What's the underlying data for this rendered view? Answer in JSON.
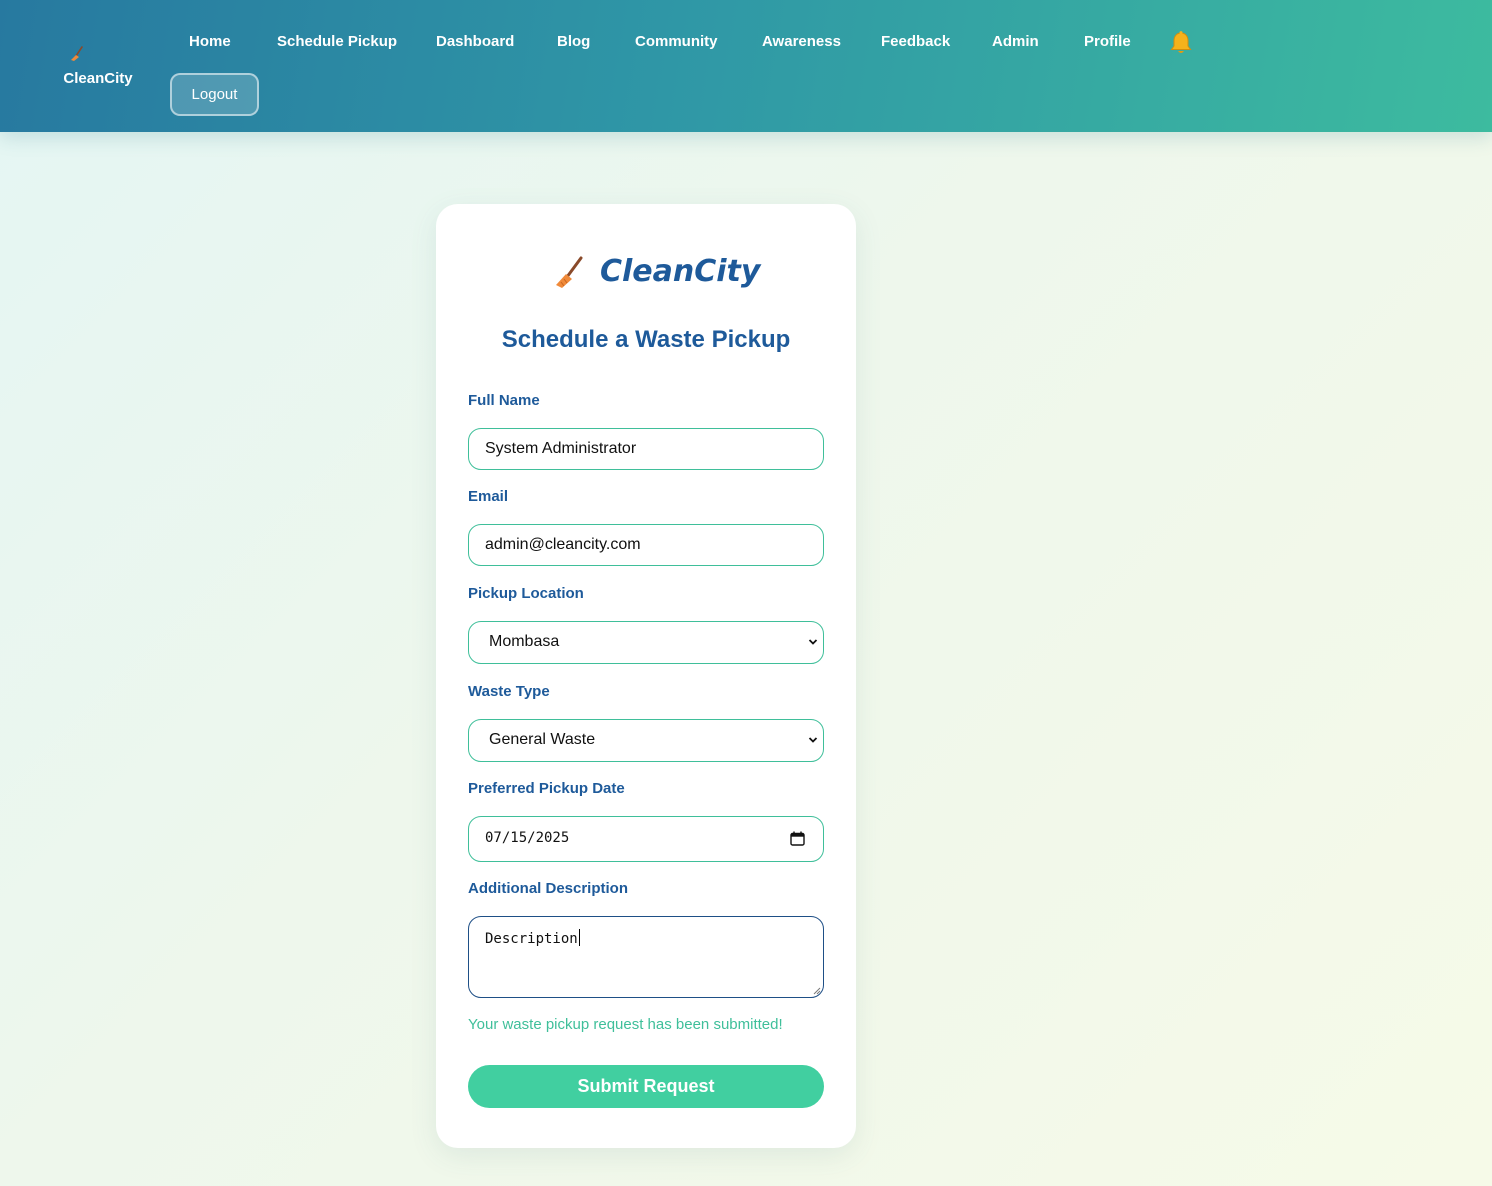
{
  "header": {
    "brand_name": "CleanCity",
    "nav": [
      {
        "label": "Home"
      },
      {
        "label": "Schedule Pickup"
      },
      {
        "label": "Dashboard"
      },
      {
        "label": "Blog"
      },
      {
        "label": "Community"
      },
      {
        "label": "Awareness"
      },
      {
        "label": "Feedback"
      },
      {
        "label": "Admin"
      },
      {
        "label": "Profile"
      }
    ],
    "notification_icon": "bell-icon",
    "logout_label": "Logout"
  },
  "form": {
    "brand_name": "CleanCity",
    "brand_icon": "broom-icon",
    "title": "Schedule a Waste Pickup",
    "full_name": {
      "label": "Full Name",
      "value": "System Administrator"
    },
    "email": {
      "label": "Email",
      "value": "admin@cleancity.com"
    },
    "location": {
      "label": "Pickup Location",
      "value": "Mombasa"
    },
    "waste_type": {
      "label": "Waste Type",
      "value": "General Waste"
    },
    "pickup_date": {
      "label": "Preferred Pickup Date",
      "value": "07/15/2025"
    },
    "description": {
      "label": "Additional Description",
      "value": "Description"
    },
    "success_message": "Your waste pickup request has been submitted!",
    "submit_label": "Submit Request"
  },
  "colors": {
    "header_gradient_start": "#2779a0",
    "header_gradient_end": "#3dbb9f",
    "primary_text": "#1e5a9a",
    "accent_green": "#41cfa0",
    "success_text": "#3fbf9a"
  }
}
